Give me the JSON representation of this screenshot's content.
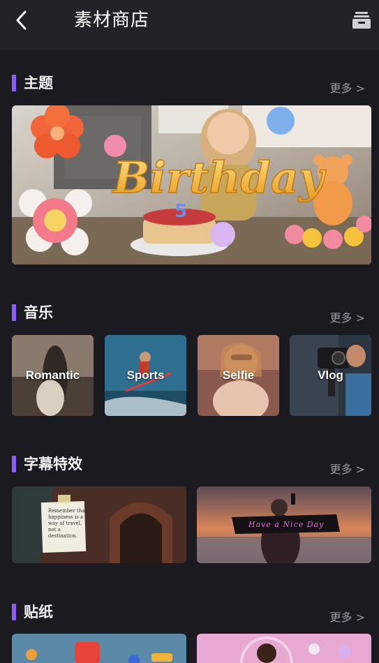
{
  "header": {
    "title": "素材商店",
    "back_icon": "chevron-left-icon",
    "library_icon": "stack-icon"
  },
  "sections": {
    "theme": {
      "title": "主题",
      "more": "更多 >",
      "banner": {
        "text": "Birthday",
        "candle_number": "5"
      }
    },
    "music": {
      "title": "音乐",
      "more": "更多 >",
      "items": [
        {
          "label": "Romantic"
        },
        {
          "label": "Sports"
        },
        {
          "label": "Selfie"
        },
        {
          "label": "Vlog"
        }
      ]
    },
    "subtitles": {
      "title": "字幕特效",
      "more": "更多 >",
      "items": [
        {
          "text": "Remember that happiness is a way of travel, not a destination."
        },
        {
          "text": "Have a Nice Day"
        }
      ]
    },
    "stickers": {
      "title": "贴纸",
      "more": "更多 >"
    }
  },
  "colors": {
    "background": "#1b1a20",
    "header": "#232229",
    "accent": "#8b5cf6",
    "muted_text": "#9a99a3"
  }
}
